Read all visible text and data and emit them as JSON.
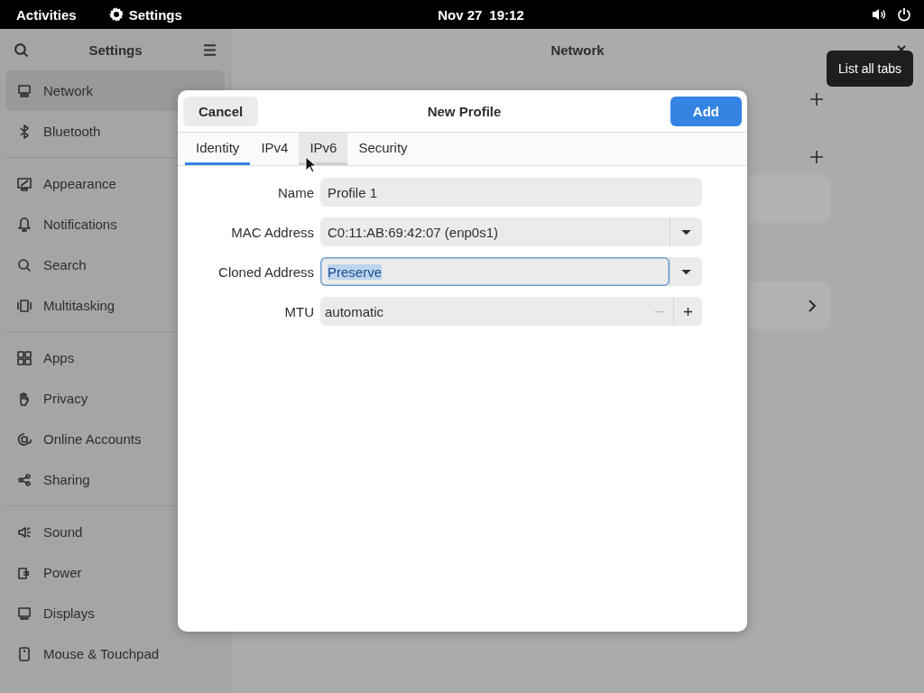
{
  "top_bar": {
    "activities": "Activities",
    "app_name": "Settings",
    "date": "Nov 27",
    "time": "19:12"
  },
  "sidebar": {
    "title": "Settings",
    "groups": [
      [
        {
          "label": "Network",
          "selected": true
        },
        {
          "label": "Bluetooth",
          "selected": false
        }
      ],
      [
        {
          "label": "Appearance",
          "selected": false
        },
        {
          "label": "Notifications",
          "selected": false
        },
        {
          "label": "Search",
          "selected": false
        },
        {
          "label": "Multitasking",
          "selected": false
        }
      ],
      [
        {
          "label": "Apps",
          "selected": false
        },
        {
          "label": "Privacy",
          "selected": false
        },
        {
          "label": "Online Accounts",
          "selected": false
        },
        {
          "label": "Sharing",
          "selected": false
        }
      ],
      [
        {
          "label": "Sound",
          "selected": false
        },
        {
          "label": "Power",
          "selected": false
        },
        {
          "label": "Displays",
          "selected": false
        },
        {
          "label": "Mouse & Touchpad",
          "selected": false
        }
      ]
    ]
  },
  "main": {
    "title": "Network"
  },
  "tooltip": {
    "text": "List all tabs"
  },
  "dialog": {
    "title": "New Profile",
    "cancel": "Cancel",
    "confirm": "Add",
    "tabs": [
      {
        "label": "Identity",
        "selected": true,
        "hovered": false
      },
      {
        "label": "IPv4",
        "selected": false,
        "hovered": false
      },
      {
        "label": "IPv6",
        "selected": false,
        "hovered": true
      },
      {
        "label": "Security",
        "selected": false,
        "hovered": false
      }
    ],
    "fields": [
      {
        "kind": "text",
        "label": "Name",
        "value": "Profile 1",
        "focused": false
      },
      {
        "kind": "dropdown",
        "label": "MAC Address",
        "value": "C0:11:AB:69:42:07 (enp0s1)",
        "focused": false
      },
      {
        "kind": "dropdown",
        "label": "Cloned Address",
        "value": "Preserve",
        "focused": true
      },
      {
        "kind": "spin",
        "label": "MTU",
        "value": "automatic",
        "focused": false,
        "minus_disabled": true
      }
    ]
  }
}
